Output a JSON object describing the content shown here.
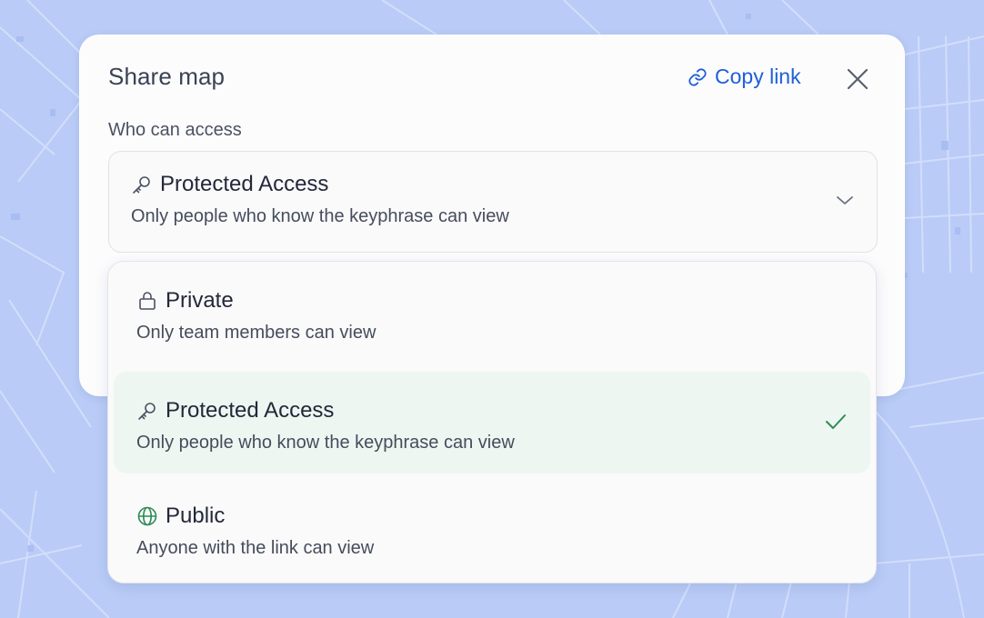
{
  "dialog": {
    "title": "Share map",
    "copy_link_label": "Copy link",
    "field_label": "Who can access"
  },
  "select": {
    "icon": "key-icon",
    "label": "Protected Access",
    "description": "Only people who know the keyphrase can view"
  },
  "options": [
    {
      "icon": "lock-icon",
      "label": "Private",
      "description": "Only team members can view",
      "selected": false
    },
    {
      "icon": "key-icon",
      "label": "Protected Access",
      "description": "Only people who know the keyphrase can view",
      "selected": true
    },
    {
      "icon": "globe-icon",
      "label": "Public",
      "description": "Anyone with the link can view",
      "selected": false
    }
  ],
  "colors": {
    "accent": "#1f5fd6",
    "selected_bg": "#eef6f1",
    "check": "#2e8b57",
    "globe": "#2e8b57",
    "map_bg": "#b9cbf6"
  }
}
